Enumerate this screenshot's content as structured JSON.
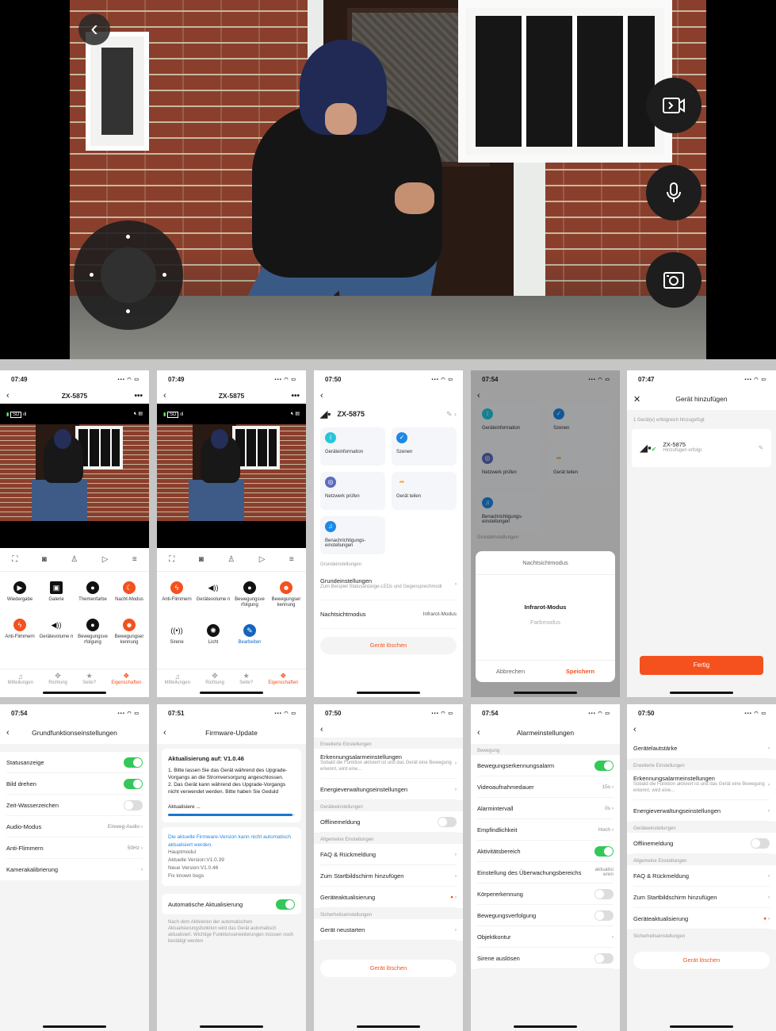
{
  "hero": {
    "back_icon": "chevron-left-icon",
    "side_buttons": [
      "video-record-icon",
      "microphone-icon",
      "camera-snapshot-icon"
    ]
  },
  "p1": {
    "time": "07:49",
    "title": "ZX-5875",
    "menu": "•••",
    "sd": "SD",
    "grid": [
      "Wiedergabe",
      "Galerie",
      "Themenfarbe",
      "Nacht-Modus",
      "Anti-Flimmern",
      "Gerätevolume n",
      "Bewegungsve rfolgung",
      "Bewegungser kennung"
    ],
    "tabs": [
      "Mitteilungen",
      "Richtung",
      "Seite?",
      "Eigenschaften"
    ]
  },
  "p2": {
    "time": "07:49",
    "title": "ZX-5875",
    "menu": "•••",
    "sd": "SD",
    "grid": [
      "Anti-Flimmern",
      "Gerätevolume n",
      "Bewegungsve rfolgung",
      "Bewegungser kennung",
      "Sirene",
      "Licht",
      "Bearbeiten"
    ],
    "tabs": [
      "Mitteilungen",
      "Richtung",
      "Seite?",
      "Eigenschaften"
    ]
  },
  "p3": {
    "time": "07:50",
    "device": "ZX-5875",
    "tiles": [
      "Geräteinformation",
      "Szenen",
      "Netzwerk prüfen",
      "Gerät teilen",
      "Benachrichtigungs-einstellungen"
    ],
    "section": "Grundeinstellungen",
    "row1_title": "Grundeinstellungen",
    "row1_sub": "Zum Beispiel Statusanzeige-LEDs und Gegensprechmodi",
    "row2_title": "Nachtsichtmodus",
    "row2_value": "Infrarot-Modus",
    "delete": "Gerät löschen"
  },
  "p4": {
    "time": "07:54",
    "tiles": [
      "Geräteinformation",
      "Szenen",
      "Netzwerk prüfen",
      "Gerät teilen",
      "Benachrichtigungs-einstellungen"
    ],
    "section": "Grundeinstellungen",
    "sheet_title": "Nachtsichtmodus",
    "opt1": "Infrarot-Modus",
    "opt2": "Farbmodus",
    "cancel": "Abbrechen",
    "save": "Speichern"
  },
  "p5": {
    "time": "07:47",
    "title": "Gerät hinzufügen",
    "note": "1 Gerät(e) erfolgreich hinzugefügt",
    "device": "ZX-5875",
    "device_sub": "Hinzufügen erfolgr.",
    "done": "Fertig"
  },
  "p6": {
    "time": "07:54",
    "title": "Grundfunktionseinstellungen",
    "rows": [
      {
        "label": "Statusanzeige",
        "toggle": "on"
      },
      {
        "label": "Bild drehen",
        "toggle": "on"
      },
      {
        "label": "Zeit-Wasserzeichen",
        "toggle": "off"
      },
      {
        "label": "Audio-Modus",
        "value": "Einweg-Audio"
      },
      {
        "label": "Anti-Flimmern",
        "value": "50Hz"
      },
      {
        "label": "Kamerakalibrierung",
        "value": ""
      }
    ]
  },
  "p7": {
    "time": "07:51",
    "title": "Firmware-Update",
    "head": "Aktualisierung auf: V1.0.46",
    "body1": "1. Bitte lassen Sie das Gerät während des Upgrade-Vorgangs an die Stromversorgung angeschlossen.",
    "body2": "2. Das Gerät kann während des Upgrade-Vorgangs nicht verwendet werden. Bitte haben Sie Geduld",
    "progress_label": "Aktualisiere ...",
    "progress": 0.98,
    "link": "Die aktuelle Firmware-Version kann nicht automatisch aktualisiert werden.",
    "lines": [
      "Hauptmodul",
      "Aktuelle Version:V1.0.39",
      "Neue Version:V1.0.46",
      "Fix known bugs"
    ],
    "auto_label": "Automatische Aktualisierung",
    "auto_note": "Nach dem Aktivieren der automatischen Aktualisierungsfunktion wird das Gerät automatisch aktualisiert. Wichtige Funktionserweiterungen müssen noch bestätigt werden"
  },
  "p8": {
    "time": "07:50",
    "sec1": "Erweiterte Einstellungen",
    "alarm_title": "Erkennungsalarmeinstellungen",
    "alarm_sub": "Sobald die Funktion aktiviert ist und das Gerät eine Bewegung erkennt, wird eine...",
    "energy": "Energieverwaltungseinstellungen",
    "sec2": "Geräteeinstellungen",
    "offline": "Offlinemeldung",
    "sec3": "Allgemeine Einstellungen",
    "faq": "FAQ & Rückmeldung",
    "homescreen": "Zum Startbildschirm hinzufügen",
    "update": "Geräteaktualisierung",
    "sec4": "Sicherheitseinstellungen",
    "restart": "Gerät neustarten",
    "delete": "Gerät löschen"
  },
  "p9": {
    "time": "07:54",
    "title": "Alarmeinstellungen",
    "section": "Bewegung",
    "rows": [
      {
        "label": "Bewegungserkennungsalarm",
        "toggle": "on"
      },
      {
        "label": "Videoaufnahmedauer",
        "value": "15s"
      },
      {
        "label": "Alarmintervall",
        "value": "0s"
      },
      {
        "label": "Empfindlichkeit",
        "value": "Hoch"
      },
      {
        "label": "Aktivitätsbereich",
        "toggle": "on"
      },
      {
        "label": "Einstellung des Überwachungsbereichs",
        "value": "aktualisieren"
      },
      {
        "label": "Körpererkennung",
        "toggle": "off"
      },
      {
        "label": "Bewegungsverfolgung",
        "toggle": "off"
      },
      {
        "label": "Objektkontur",
        "value": ""
      },
      {
        "label": "Sirene auslösen",
        "toggle": "off"
      }
    ]
  },
  "p10": {
    "time": "07:50",
    "volume": "Gerätelautstärke",
    "sec1": "Erweiterte Einstellungen",
    "alarm_title": "Erkennungsalarmeinstellungen",
    "alarm_sub": "Sobald die Funktion aktiviert ist und das Gerät eine Bewegung erkennt, wird eine...",
    "energy": "Energieverwaltungseinstellungen",
    "sec2": "Geräteeinstellungen",
    "offline": "Offlinemeldung",
    "sec3": "Allgemeine Einstellungen",
    "faq": "FAQ & Rückmeldung",
    "homescreen": "Zum Startbildschirm hinzufügen",
    "update": "Geräteaktualisierung",
    "sec4": "Sicherheitseinstellungen",
    "delete": "Gerät löschen"
  }
}
